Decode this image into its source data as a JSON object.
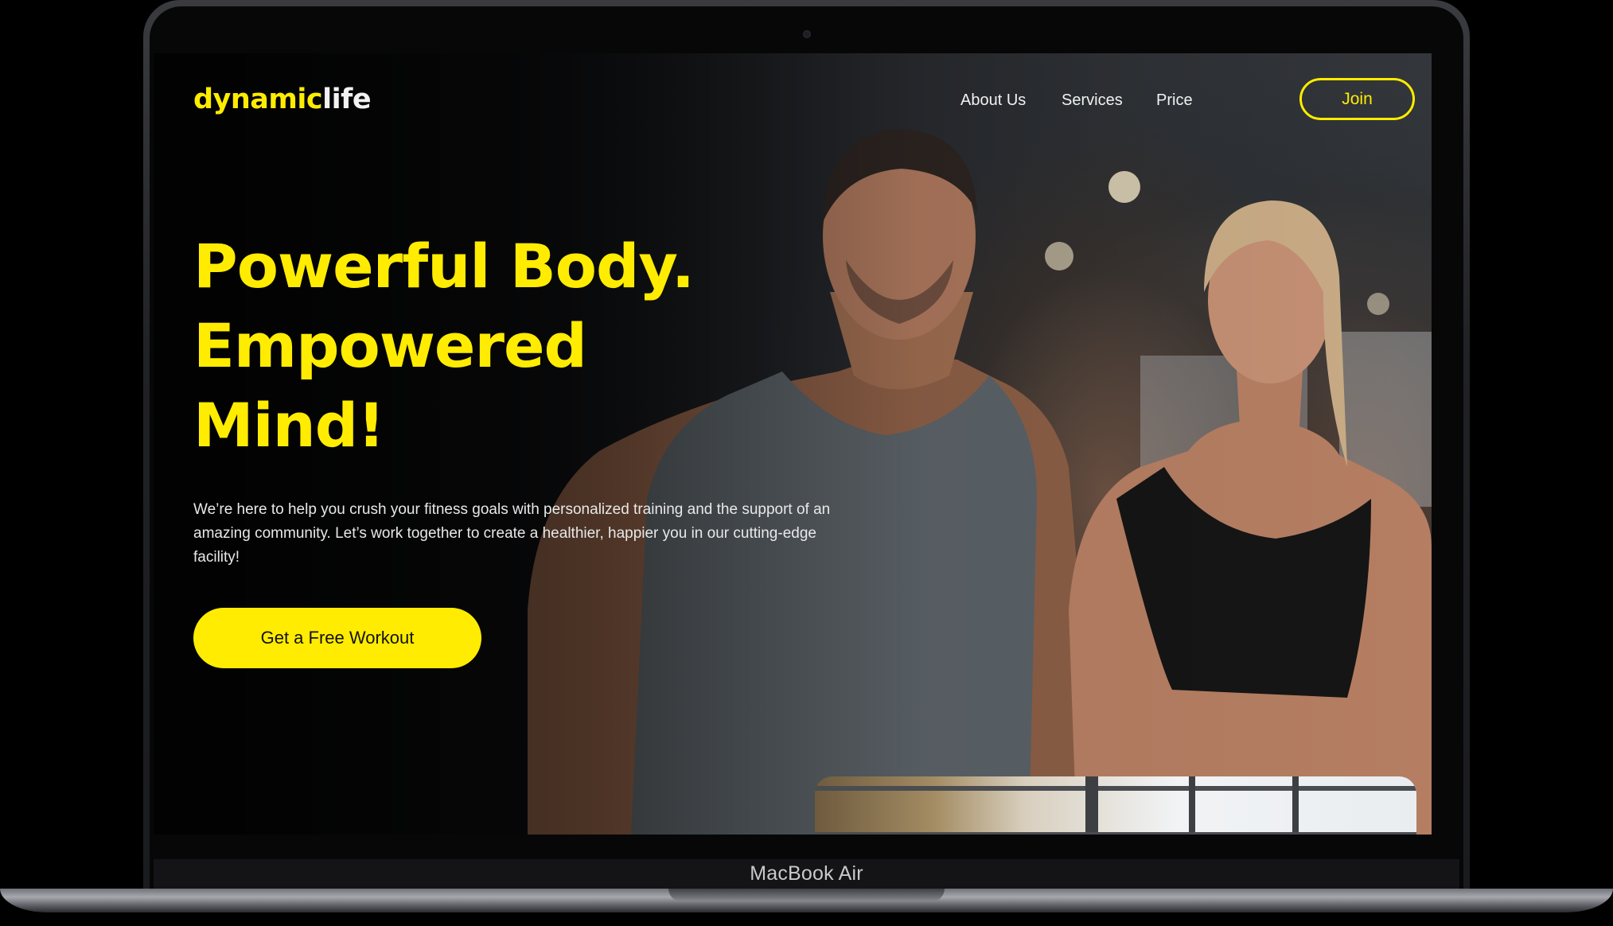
{
  "site": {
    "logo": {
      "part1": "dynamic",
      "part2": "life"
    },
    "nav": {
      "links": [
        "About Us",
        "Services",
        "Price"
      ],
      "join_label": "Join"
    },
    "hero": {
      "title_lines": [
        "Powerful Body.",
        "Empowered",
        "Mind!"
      ],
      "description": "We’re here to help you crush your fitness goals with personalized training and the support of an amazing community. Let’s work together to create a healthier, happier you in our cutting-edge facility!",
      "cta_label": "Get a Free Workout"
    }
  },
  "device": {
    "label": "MacBook Air"
  },
  "colors": {
    "accent": "#ffec00",
    "text_light": "#f1f1f1",
    "background": "#000000"
  }
}
